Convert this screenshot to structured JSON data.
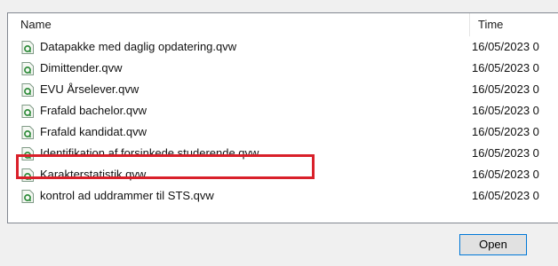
{
  "columns": {
    "name": "Name",
    "time": "Time"
  },
  "files": [
    {
      "name": "Datapakke med daglig opdatering.qvw",
      "time": "16/05/2023 0",
      "icon": "qlikview-document-icon"
    },
    {
      "name": "Dimittender.qvw",
      "time": "16/05/2023 0",
      "icon": "qlikview-document-icon"
    },
    {
      "name": "EVU Årselever.qvw",
      "time": "16/05/2023 0",
      "icon": "qlikview-document-icon"
    },
    {
      "name": "Frafald bachelor.qvw",
      "time": "16/05/2023 0",
      "icon": "qlikview-document-icon"
    },
    {
      "name": "Frafald kandidat.qvw",
      "time": "16/05/2023 0",
      "icon": "qlikview-document-icon"
    },
    {
      "name": "Identifikation af forsinkede studerende.qvw",
      "time": "16/05/2023 0",
      "icon": "qlikview-document-icon",
      "highlighted": true
    },
    {
      "name": "Karakterstatistik.qvw",
      "time": "16/05/2023 0",
      "icon": "qlikview-document-icon"
    },
    {
      "name": "kontrol ad uddrammer til STS.qvw",
      "time": "16/05/2023 0",
      "icon": "qlikview-document-icon"
    }
  ],
  "highlight_color": "#d9202a",
  "button_accent": "#0078d7",
  "open_button_label": "Open"
}
